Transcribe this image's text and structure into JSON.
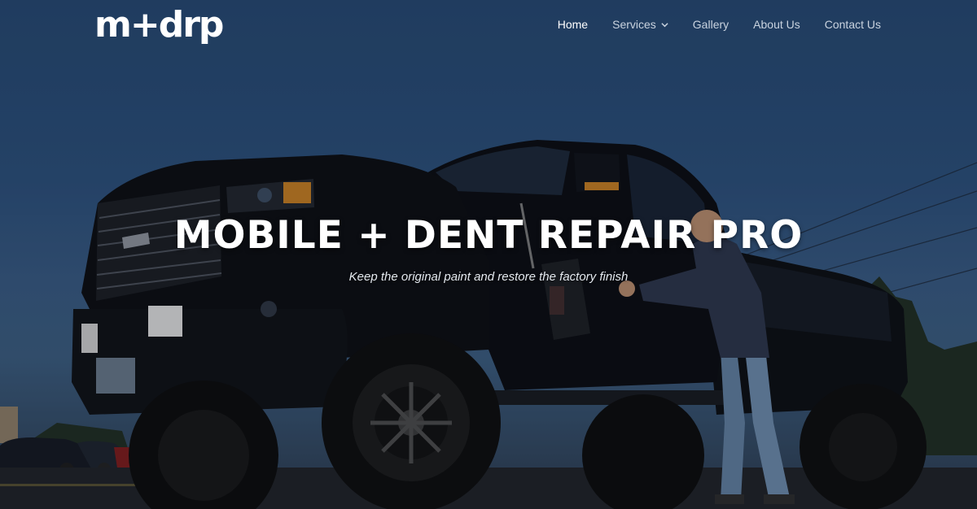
{
  "header": {
    "logo_text": "m+drp",
    "nav": [
      {
        "label": "Home",
        "active": true
      },
      {
        "label": "Services",
        "has_dropdown": true
      },
      {
        "label": "Gallery"
      },
      {
        "label": "About Us"
      },
      {
        "label": "Contact Us"
      }
    ]
  },
  "hero": {
    "headline": "MOBILE + DENT REPAIR PRO",
    "tagline": "Keep the original paint and restore the factory finish"
  },
  "colors": {
    "sky": "#2a4d77",
    "nav_text": "#c9d3df",
    "nav_active": "#ffffff",
    "truck": "#0d0f13"
  }
}
